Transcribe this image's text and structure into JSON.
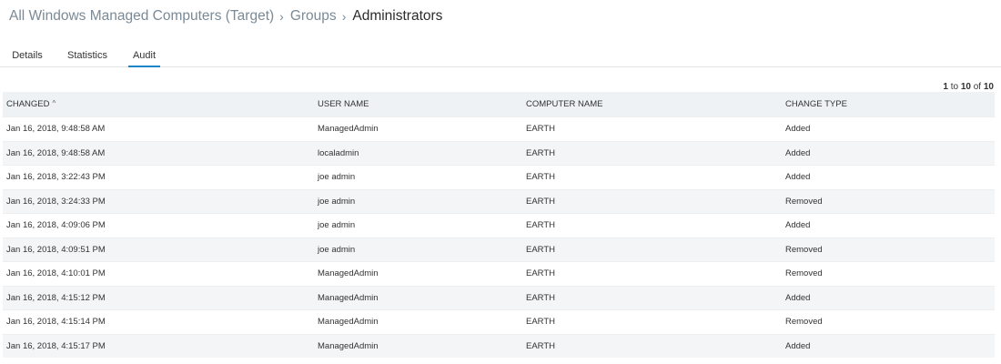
{
  "breadcrumb": {
    "items": [
      "All Windows Managed Computers (Target)",
      "Groups"
    ],
    "separator": "›",
    "current": "Administrators"
  },
  "tabs": [
    {
      "label": "Details",
      "active": false
    },
    {
      "label": "Statistics",
      "active": false
    },
    {
      "label": "Audit",
      "active": true
    }
  ],
  "pager": {
    "from": "1",
    "to_word": "to",
    "to": "10",
    "of_word": "of",
    "total": "10"
  },
  "table": {
    "columns": [
      "CHANGED",
      "USER NAME",
      "COMPUTER NAME",
      "CHANGE TYPE"
    ],
    "sort_icon": "^",
    "rows": [
      [
        "Jan 16, 2018, 9:48:58 AM",
        "ManagedAdmin",
        "EARTH",
        "Added"
      ],
      [
        "Jan 16, 2018, 9:48:58 AM",
        "localadmin",
        "EARTH",
        "Added"
      ],
      [
        "Jan 16, 2018, 3:22:43 PM",
        "joe admin",
        "EARTH",
        "Added"
      ],
      [
        "Jan 16, 2018, 3:24:33 PM",
        "joe admin",
        "EARTH",
        "Removed"
      ],
      [
        "Jan 16, 2018, 4:09:06 PM",
        "joe admin",
        "EARTH",
        "Added"
      ],
      [
        "Jan 16, 2018, 4:09:51 PM",
        "joe admin",
        "EARTH",
        "Removed"
      ],
      [
        "Jan 16, 2018, 4:10:01 PM",
        "ManagedAdmin",
        "EARTH",
        "Removed"
      ],
      [
        "Jan 16, 2018, 4:15:12 PM",
        "ManagedAdmin",
        "EARTH",
        "Added"
      ],
      [
        "Jan 16, 2018, 4:15:14 PM",
        "ManagedAdmin",
        "EARTH",
        "Removed"
      ],
      [
        "Jan 16, 2018, 4:15:17 PM",
        "ManagedAdmin",
        "EARTH",
        "Added"
      ]
    ]
  },
  "colors": {
    "accent": "#1b87c9",
    "header_bg": "#eef2f4",
    "stripe_bg": "#f3f5f6"
  }
}
